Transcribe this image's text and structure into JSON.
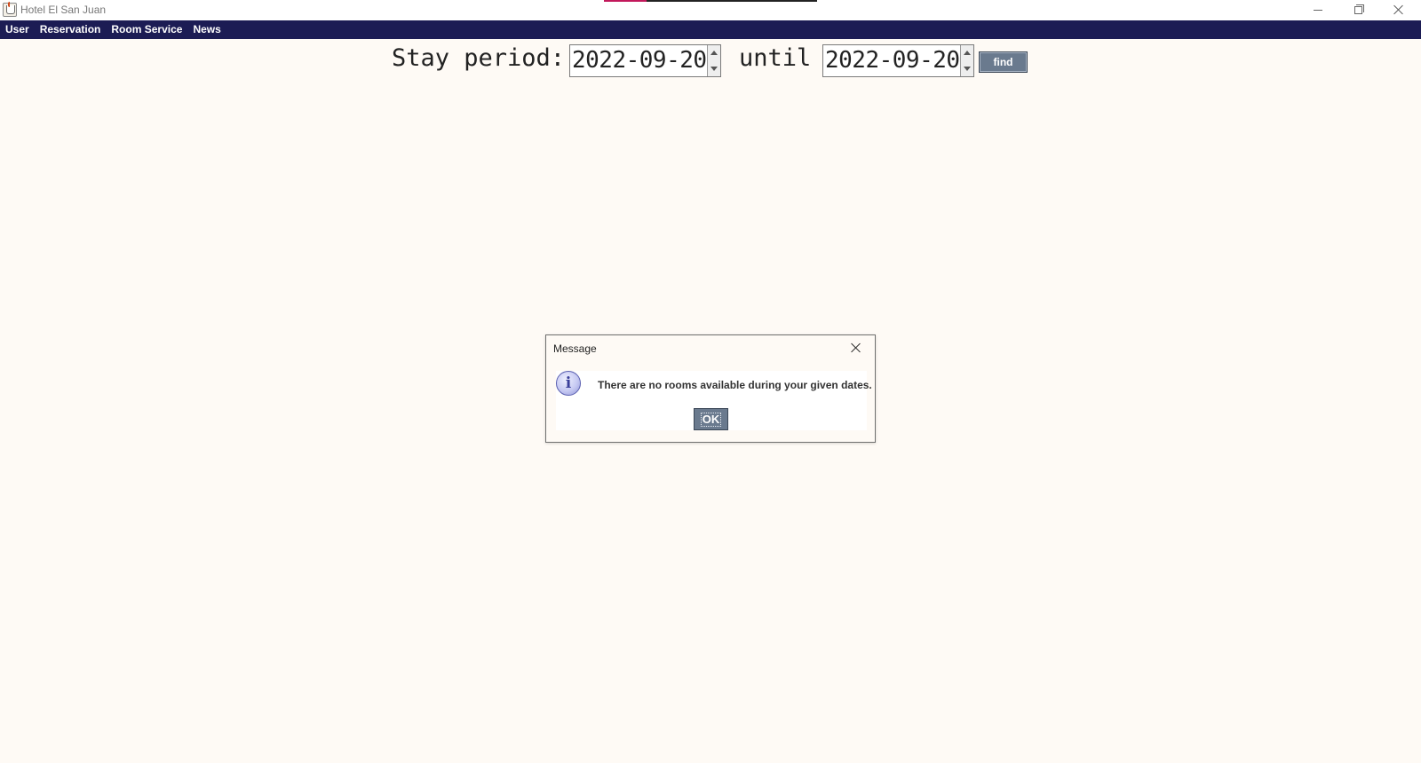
{
  "window": {
    "title": "Hotel El San Juan",
    "icons": {
      "app": "java-cup-icon",
      "minimize": "minimize-icon",
      "maximize": "restore-icon",
      "close": "close-icon"
    }
  },
  "menu": {
    "items": [
      {
        "label": "User"
      },
      {
        "label": "Reservation"
      },
      {
        "label": "Room Service"
      },
      {
        "label": "News"
      }
    ]
  },
  "search": {
    "stay_label": "Stay period:",
    "from_date": "2022-09-20",
    "until_label": "until",
    "to_date": "2022-09-20",
    "find_label": "find"
  },
  "dialog": {
    "title": "Message",
    "message": "There are no rooms available during your given dates.",
    "ok_label": "OK",
    "icon": "info-icon"
  },
  "colors": {
    "menubar": "#1c1c54",
    "background": "#fefaf5",
    "button": "#6a7a8e"
  }
}
